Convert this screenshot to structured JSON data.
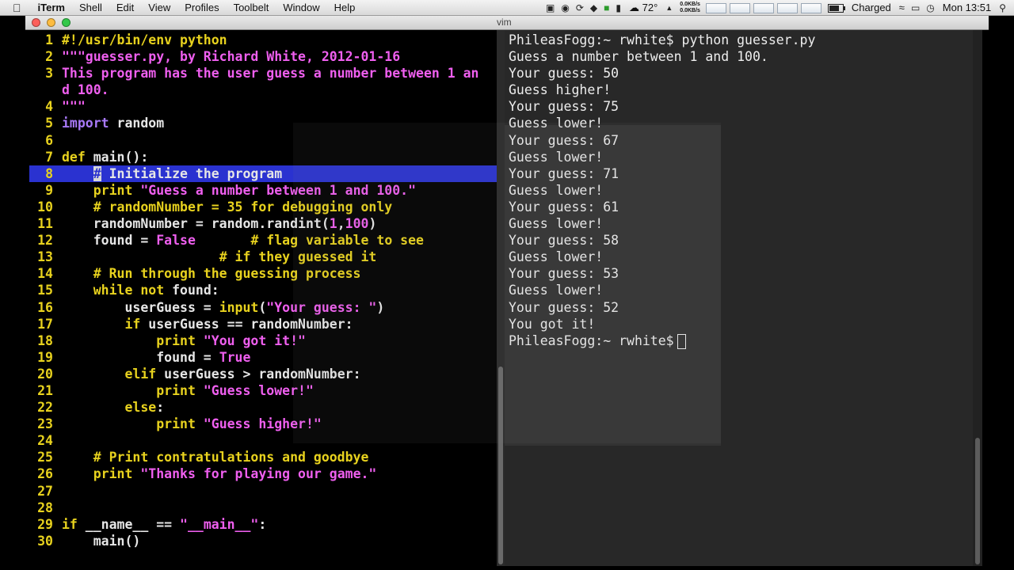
{
  "menubar": {
    "apple": "",
    "app": "iTerm",
    "items": [
      "Shell",
      "Edit",
      "View",
      "Profiles",
      "Toolbelt",
      "Window",
      "Help"
    ],
    "temperature": "72°",
    "net_up": "0.0KB/s",
    "net_down": "0.0KB/s",
    "battery_status": "Charged",
    "clock": "Mon 13:51"
  },
  "window": {
    "title": "vim"
  },
  "editor": {
    "lines": [
      {
        "n": "1",
        "segs": [
          [
            "#!/usr/bin/env python",
            "yellow"
          ]
        ]
      },
      {
        "n": "2",
        "segs": [
          [
            "\"\"\"guesser.py, by Richard White, 2012-01-16",
            "pink"
          ]
        ]
      },
      {
        "n": "3",
        "segs": [
          [
            "This program has the user guess a number between 1 an",
            "pink"
          ]
        ]
      },
      {
        "n": "",
        "segs": [
          [
            "d 100.",
            "pink"
          ]
        ]
      },
      {
        "n": "4",
        "segs": [
          [
            "\"\"\"",
            "pink"
          ]
        ]
      },
      {
        "n": "5",
        "segs": [
          [
            "import",
            "purple"
          ],
          [
            " random",
            "norm"
          ]
        ]
      },
      {
        "n": "6",
        "segs": []
      },
      {
        "n": "7",
        "segs": [
          [
            "def",
            "yellow"
          ],
          [
            " main():",
            "norm"
          ]
        ]
      },
      {
        "n": "8",
        "hl": true,
        "segs": [
          [
            "    ",
            "norm"
          ],
          [
            "#",
            "cursor"
          ],
          [
            " Initialize the program",
            "norm"
          ]
        ]
      },
      {
        "n": "9",
        "segs": [
          [
            "    ",
            "norm"
          ],
          [
            "print",
            "yellow"
          ],
          [
            " \"Guess a number between 1 and 100.\"",
            "pink"
          ]
        ]
      },
      {
        "n": "10",
        "segs": [
          [
            "    # randomNumber = 35 for debugging only",
            "yellow"
          ]
        ]
      },
      {
        "n": "11",
        "segs": [
          [
            "    randomNumber = random.randint(",
            "norm"
          ],
          [
            "1",
            "pink"
          ],
          [
            ",",
            "norm"
          ],
          [
            "100",
            "pink"
          ],
          [
            ")",
            "norm"
          ]
        ]
      },
      {
        "n": "12",
        "segs": [
          [
            "    found = ",
            "norm"
          ],
          [
            "False",
            "pink"
          ],
          [
            "       ",
            "norm"
          ],
          [
            "# flag variable to see",
            "yellow"
          ]
        ]
      },
      {
        "n": "13",
        "segs": [
          [
            "                    ",
            "norm"
          ],
          [
            "# if they guessed it",
            "yellow"
          ]
        ]
      },
      {
        "n": "14",
        "segs": [
          [
            "    # Run through the guessing process",
            "yellow"
          ]
        ]
      },
      {
        "n": "15",
        "segs": [
          [
            "    ",
            "norm"
          ],
          [
            "while not",
            "yellow"
          ],
          [
            " found:",
            "norm"
          ]
        ]
      },
      {
        "n": "16",
        "segs": [
          [
            "        userGuess = ",
            "norm"
          ],
          [
            "input",
            "yellow"
          ],
          [
            "(",
            "norm"
          ],
          [
            "\"Your guess: \"",
            "pink"
          ],
          [
            ")",
            "norm"
          ]
        ]
      },
      {
        "n": "17",
        "segs": [
          [
            "        ",
            "norm"
          ],
          [
            "if",
            "yellow"
          ],
          [
            " userGuess == randomNumber:",
            "norm"
          ]
        ]
      },
      {
        "n": "18",
        "segs": [
          [
            "            ",
            "norm"
          ],
          [
            "print",
            "yellow"
          ],
          [
            " \"You got it!\"",
            "pink"
          ]
        ]
      },
      {
        "n": "19",
        "segs": [
          [
            "            found = ",
            "norm"
          ],
          [
            "True",
            "pink"
          ]
        ]
      },
      {
        "n": "20",
        "segs": [
          [
            "        ",
            "norm"
          ],
          [
            "elif",
            "yellow"
          ],
          [
            " userGuess > randomNumber:",
            "norm"
          ]
        ]
      },
      {
        "n": "21",
        "segs": [
          [
            "            ",
            "norm"
          ],
          [
            "print",
            "yellow"
          ],
          [
            " \"Guess lower!\"",
            "pink"
          ]
        ]
      },
      {
        "n": "22",
        "segs": [
          [
            "        ",
            "norm"
          ],
          [
            "else",
            "yellow"
          ],
          [
            ":",
            "norm"
          ]
        ]
      },
      {
        "n": "23",
        "segs": [
          [
            "            ",
            "norm"
          ],
          [
            "print",
            "yellow"
          ],
          [
            " \"Guess higher!\"",
            "pink"
          ]
        ]
      },
      {
        "n": "24",
        "segs": []
      },
      {
        "n": "25",
        "segs": [
          [
            "    # Print contratulations and goodbye",
            "yellow"
          ]
        ]
      },
      {
        "n": "26",
        "segs": [
          [
            "    ",
            "norm"
          ],
          [
            "print",
            "yellow"
          ],
          [
            " \"Thanks for playing our game.\"",
            "pink"
          ]
        ]
      },
      {
        "n": "27",
        "segs": []
      },
      {
        "n": "28",
        "segs": []
      },
      {
        "n": "29",
        "segs": [
          [
            "if",
            "yellow"
          ],
          [
            " __name__ == ",
            "norm"
          ],
          [
            "\"__main__\"",
            "pink"
          ],
          [
            ":",
            "norm"
          ]
        ]
      },
      {
        "n": "30",
        "segs": [
          [
            "    main()",
            "norm"
          ]
        ]
      }
    ]
  },
  "terminal": {
    "lines": [
      "PhileasFogg:~ rwhite$ python guesser.py",
      "Guess a number between 1 and 100.",
      "Your guess: 50",
      "Guess higher!",
      "Your guess: 75",
      "Guess lower!",
      "Your guess: 67",
      "Guess lower!",
      "Your guess: 71",
      "Guess lower!",
      "Your guess: 61",
      "Guess lower!",
      "Your guess: 58",
      "Guess lower!",
      "Your guess: 53",
      "Guess lower!",
      "Your guess: 52",
      "You got it!"
    ],
    "prompt": "PhileasFogg:~ rwhite$"
  },
  "icons": [
    "apple-icon",
    "screen-icon",
    "vpn-icon",
    "time-machine-icon",
    "dropbox-icon",
    "evernote-icon",
    "temperature-icon",
    "wifi-icon",
    "display-icon",
    "clock-icon",
    "battery-icon"
  ]
}
